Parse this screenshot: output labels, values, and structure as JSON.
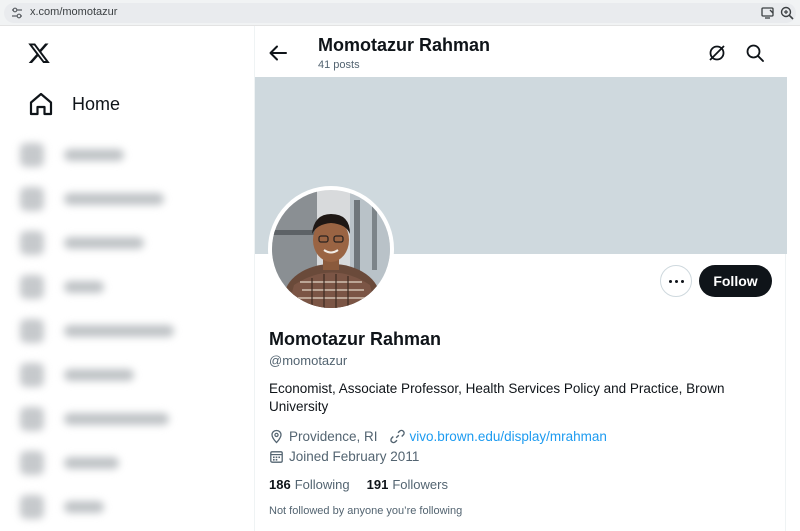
{
  "browser": {
    "url": "x.com/momotazur"
  },
  "sidebar": {
    "logo_icon": "x-logo-icon",
    "home_label": "Home"
  },
  "header": {
    "name": "Momotazur Rahman",
    "posts": "41 posts"
  },
  "profile": {
    "name": "Momotazur Rahman",
    "handle": "@momotazur",
    "bio": "Economist, Associate Professor, Health Services Policy and Practice, Brown University",
    "location": "Providence, RI",
    "website": "vivo.brown.edu/display/mrahman",
    "joined": "Joined February 2011",
    "following_count": "186",
    "following_label": "Following",
    "followers_count": "191",
    "followers_label": "Followers",
    "followed_by_text": "Not followed by anyone you’re following",
    "follow_button": "Follow"
  },
  "colors": {
    "banner": "#cfd9de",
    "link": "#1d9bf0",
    "follow_button_bg": "#0f1419"
  }
}
